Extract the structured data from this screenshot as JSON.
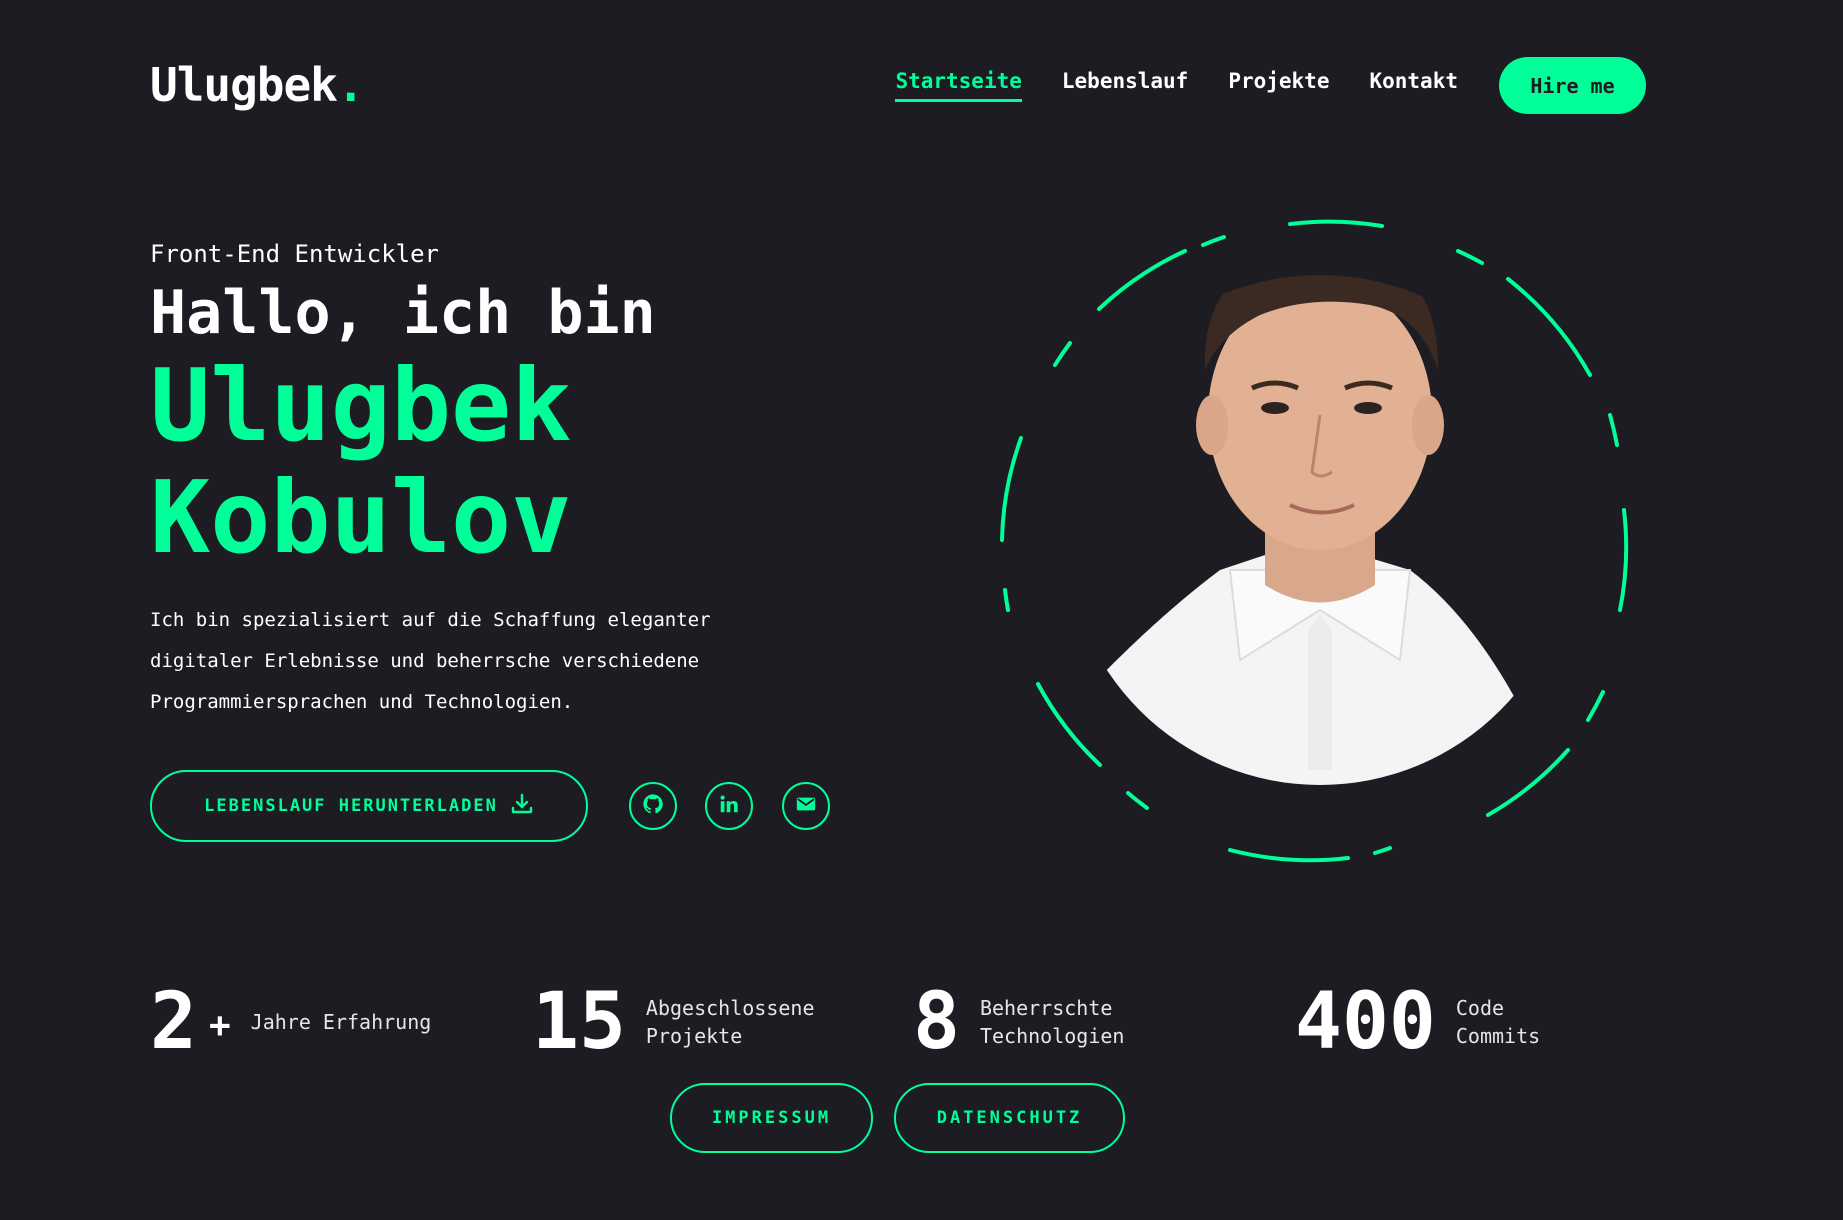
{
  "header": {
    "logo": "Ulugbek",
    "logo_dot": ".",
    "nav": [
      {
        "label": "Startseite",
        "active": true
      },
      {
        "label": "Lebenslauf",
        "active": false
      },
      {
        "label": "Projekte",
        "active": false
      },
      {
        "label": "Kontakt",
        "active": false
      }
    ],
    "hire_label": "Hire me"
  },
  "hero": {
    "subtitle": "Front-End Entwickler",
    "greeting": "Hallo, ich bin",
    "first_name": "Ulugbek",
    "last_name": "Kobulov",
    "description_lines": [
      "Ich bin spezialisiert auf die Schaffung eleganter",
      "digitaler Erlebnisse und beherrsche verschiedene",
      "Programmiersprachen und Technologien."
    ],
    "cv_button": "LEBENSLAUF HERUNTERLADEN",
    "socials": [
      "github-icon",
      "linkedin-icon",
      "email-icon"
    ]
  },
  "stats": [
    {
      "value": "2",
      "suffix": "+",
      "label_lines": [
        "Jahre Erfahrung"
      ]
    },
    {
      "value": "15",
      "suffix": "",
      "label_lines": [
        "Abgeschlossene",
        "Projekte"
      ]
    },
    {
      "value": "8",
      "suffix": "",
      "label_lines": [
        "Beherrschte",
        "Technologien"
      ]
    },
    {
      "value": "400",
      "suffix": "",
      "label_lines": [
        "Code",
        "Commits"
      ]
    }
  ],
  "footer": {
    "impressum": "IMPRESSUM",
    "datenschutz": "DATENSCHUTZ"
  },
  "colors": {
    "background": "#1c1c22",
    "accent": "#00ff99",
    "text": "#ffffff"
  }
}
